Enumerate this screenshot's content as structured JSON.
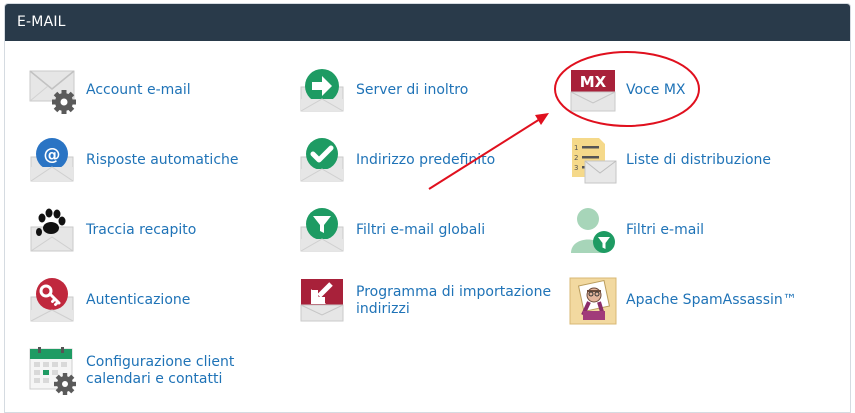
{
  "section": {
    "title": "E-MAIL"
  },
  "items": [
    {
      "label": "Account e-mail",
      "icon": "mail-gear-icon"
    },
    {
      "label": "Server di inoltro",
      "icon": "forwarder-arrow-icon"
    },
    {
      "label": "Voce MX",
      "icon": "mx-entry-icon"
    },
    {
      "label": "Risposte automatiche",
      "icon": "at-sign-icon"
    },
    {
      "label": "Indirizzo predefinito",
      "icon": "default-checkmark-icon"
    },
    {
      "label": "Liste di distribuzione",
      "icon": "mailing-list-icon"
    },
    {
      "label": "Traccia recapito",
      "icon": "paw-print-icon"
    },
    {
      "label": "Filtri e-mail globali",
      "icon": "global-filter-icon"
    },
    {
      "label": "Filtri e-mail",
      "icon": "user-filter-icon"
    },
    {
      "label": "Autenticazione",
      "icon": "key-icon"
    },
    {
      "label": "Programma di importazione indirizzi",
      "icon": "import-arrow-icon"
    },
    {
      "label": "Apache SpamAssassin™",
      "icon": "spamassassin-icon"
    },
    {
      "label": "Configurazione client calendari e contatti",
      "icon": "calendar-gear-icon"
    }
  ],
  "mx_badge": "MX",
  "colors": {
    "header_bg": "#293a4a",
    "link": "#1f73b7",
    "green": "#1e9b63",
    "red": "#c0283d",
    "blue": "#2a74c4",
    "annotation": "#e0101e"
  }
}
